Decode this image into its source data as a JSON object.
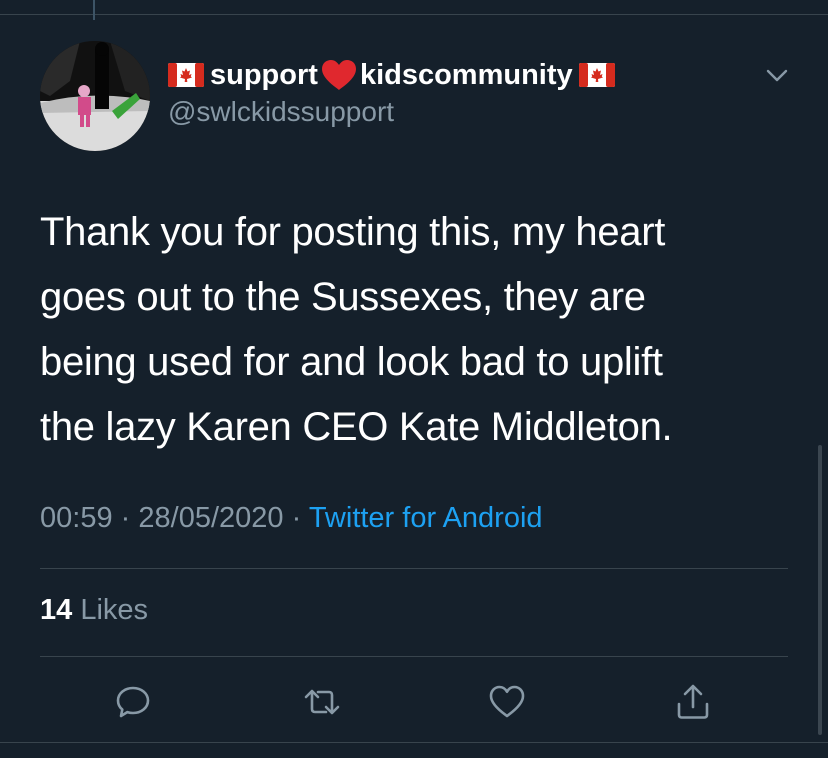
{
  "tweet": {
    "display_name_part1": "support",
    "display_name_part2": "kidscommunity",
    "handle": "@swlckidssupport",
    "text": "Thank you for posting this, my heart\ngoes out to the Sussexes, they are\nbeing used for and look bad to uplift\nthe lazy Karen CEO Kate Middleton.",
    "time": "00:59",
    "separator": "·",
    "date": "28/05/2020",
    "source": "Twitter for Android",
    "likes_count": "14",
    "likes_label": "Likes"
  },
  "icons": {
    "flag": "canada-flag-icon",
    "heart": "red-heart-icon",
    "menu": "chevron-down-icon",
    "reply": "reply-icon",
    "retweet": "retweet-icon",
    "like": "like-icon",
    "share": "share-icon"
  },
  "colors": {
    "background": "#15202b",
    "text_primary": "#ffffff",
    "text_secondary": "#8899a6",
    "link": "#1da1f2",
    "divider": "#38444d",
    "heart_red": "#e0282e",
    "flag_red": "#d52b1e"
  }
}
